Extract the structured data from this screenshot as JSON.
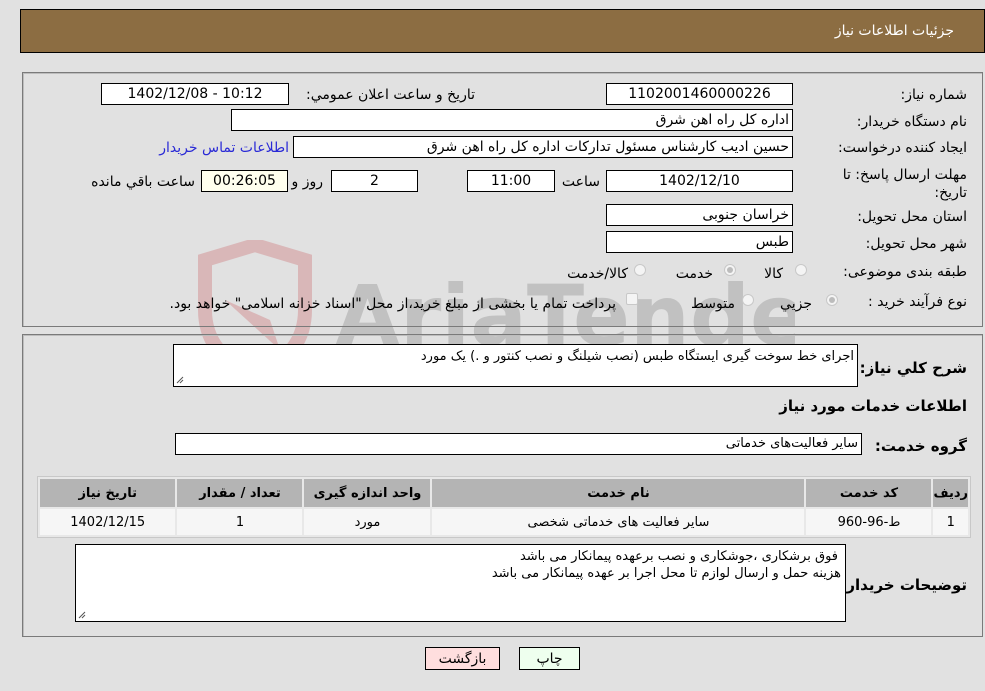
{
  "header": {
    "title": "جزئیات اطلاعات نیاز"
  },
  "form": {
    "need_number": {
      "label": "شماره نیاز:",
      "value": "1102001460000226"
    },
    "announce_datetime": {
      "label": "تاریخ و ساعت اعلان عمومي:",
      "value": "1402/12/08 - 10:12"
    },
    "buyer_org": {
      "label": "نام دستگاه خریدار:",
      "value": "اداره کل راه اهن شرق"
    },
    "requester": {
      "label": "ایجاد کننده درخواست:",
      "value": "حسین ادیب کارشناس مسئول تدارکات اداره کل راه اهن شرق"
    },
    "buyer_contact_link": "اطلاعات تماس خریدار",
    "deadline": {
      "label": "مهلت ارسال پاسخ: تا تاریخ:",
      "date": "1402/12/10",
      "time_label": "ساعت",
      "time": "11:00",
      "days": "2",
      "days_label": "روز و",
      "remaining": "00:26:05",
      "remaining_label": "ساعت باقي مانده"
    },
    "province": {
      "label": "استان محل تحویل:",
      "value": "خراسان جنوبی"
    },
    "city": {
      "label": "شهر محل تحویل:",
      "value": "طبس"
    },
    "category": {
      "label": "طبقه بندی موضوعی:",
      "options": [
        "کالا",
        "خدمت",
        "کالا/خدمت"
      ],
      "selected": "خدمت"
    },
    "purchase_type": {
      "label": "نوع فرآیند خرید :",
      "options": [
        "جزيي",
        "متوسط"
      ],
      "selected": "جزيي",
      "treasury_note": "پرداخت تمام یا بخشی از مبلغ خرید،از محل \"اسناد خزانه اسلامی\" خواهد بود."
    }
  },
  "description": {
    "label": "شرح کلي نياز:",
    "value": "اجرای خط سوخت گیری ایستگاه طبس (نصب شیلنگ و نصب کنتور و .)  یک مورد"
  },
  "services_section": {
    "title": "اطلاعات خدمات مورد نياز",
    "group_label": "گروه خدمت:",
    "group_value": "سایر فعالیت‌های خدماتی"
  },
  "table": {
    "headers": [
      "رديف",
      "کد خدمت",
      "نام خدمت",
      "واحد اندازه گيری",
      "تعداد / مقدار",
      "تاريخ نياز"
    ],
    "rows": [
      [
        "1",
        "ط-96-960",
        "سایر فعالیت های خدماتی شخصی",
        "مورد",
        "1",
        "1402/12/15"
      ]
    ]
  },
  "buyer_notes": {
    "label": "توضيحات خريدار:",
    "lines": [
      "فوق برشکاری ،جوشکاری و نصب برعهده پیمانکار می باشد",
      "هزینه حمل و ارسال لوازم تا محل اجرا بر عهده پیمانکار می باشد"
    ]
  },
  "buttons": {
    "print": "چاپ",
    "back": "بازگشت"
  },
  "watermark": {
    "text": "AriaTender.neT"
  },
  "colors": {
    "header_bg": "#8c6d42",
    "link": "#2929d6",
    "print_bg": "#eeffee",
    "back_bg": "#ffdede",
    "remaining_bg": "#ffffee"
  }
}
